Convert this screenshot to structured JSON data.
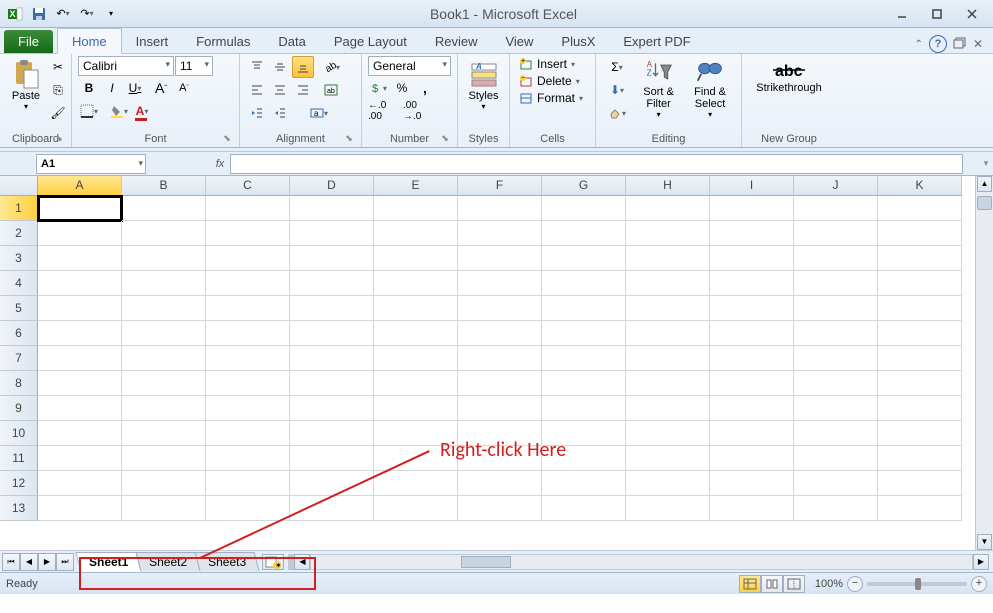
{
  "title": "Book1 - Microsoft Excel",
  "qat": {
    "save": "💾",
    "undo": "↶",
    "redo": "↷"
  },
  "tabs": {
    "file": "File",
    "items": [
      "Home",
      "Insert",
      "Formulas",
      "Data",
      "Page Layout",
      "Review",
      "View",
      "PlusX",
      "Expert PDF"
    ],
    "active": "Home"
  },
  "ribbon": {
    "clipboard": {
      "label": "Clipboard",
      "paste": "Paste",
      "cut": "✂",
      "copy": "⎘",
      "brush": "🖌"
    },
    "font": {
      "label": "Font",
      "name": "Calibri",
      "size": "11",
      "bold": "B",
      "italic": "I",
      "underline": "U",
      "increase": "A",
      "decrease": "A"
    },
    "alignment": {
      "label": "Alignment"
    },
    "number": {
      "label": "Number",
      "format": "General",
      "currency": "💲",
      "percent": "%",
      "comma": ",",
      "incdec": "⁺⁰₀",
      "decdec": "⁻⁰₀"
    },
    "styles": {
      "label": "Styles",
      "btn": "Styles"
    },
    "cells": {
      "label": "Cells",
      "insert": "Insert",
      "delete": "Delete",
      "format": "Format"
    },
    "editing": {
      "label": "Editing",
      "sum": "Σ",
      "fill": "⬇",
      "clear": "◇",
      "sort": "Sort & Filter",
      "find": "Find & Select"
    },
    "newgroup": {
      "label": "New Group",
      "strike": "Strikethrough"
    }
  },
  "namebox": "A1",
  "fx": "fx",
  "columns": [
    "A",
    "B",
    "C",
    "D",
    "E",
    "F",
    "G",
    "H",
    "I",
    "J",
    "K"
  ],
  "rows": [
    "1",
    "2",
    "3",
    "4",
    "5",
    "6",
    "7",
    "8",
    "9",
    "10",
    "11",
    "12",
    "13"
  ],
  "active_cell": {
    "row": 0,
    "col": 0
  },
  "sheet_tabs": [
    "Sheet1",
    "Sheet2",
    "Sheet3"
  ],
  "active_sheet": 0,
  "status": {
    "ready": "Ready",
    "zoom": "100%"
  },
  "annotation": {
    "text": "Right-click Here"
  }
}
